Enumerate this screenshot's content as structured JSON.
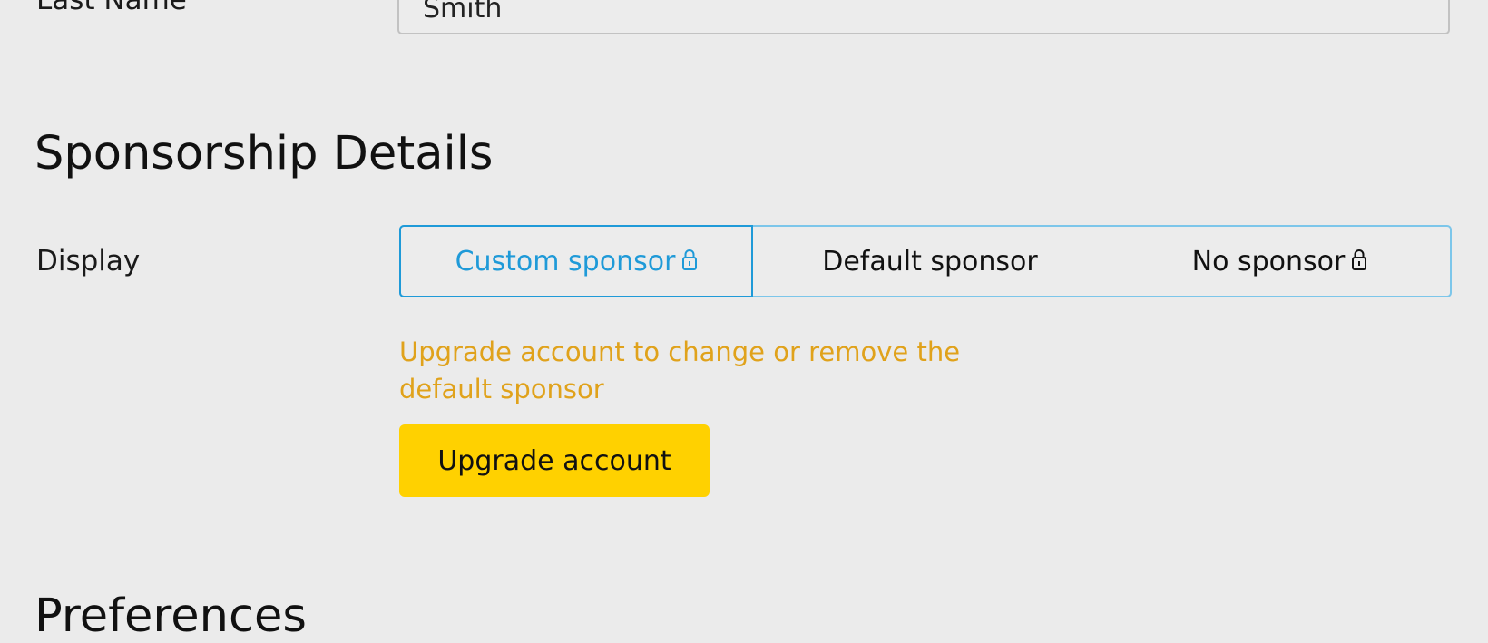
{
  "personal": {
    "last_name_label": "Last Name",
    "last_name_value": "Smith"
  },
  "sponsorship": {
    "title": "Sponsorship Details",
    "display_label": "Display",
    "options": [
      {
        "label": "Custom sponsor",
        "locked": true,
        "selected": true
      },
      {
        "label": "Default sponsor",
        "locked": false,
        "selected": false
      },
      {
        "label": "No sponsor",
        "locked": true,
        "selected": false
      }
    ],
    "upgrade_message": "Upgrade account to change or remove the default sponsor",
    "upgrade_button": "Upgrade account"
  },
  "preferences": {
    "title": "Preferences"
  },
  "colors": {
    "background": "#ebebeb",
    "accent_blue": "#1f9ad8",
    "warning_orange": "#e0a21b",
    "upgrade_yellow": "#ffd100"
  },
  "icons": {
    "lock": "lock-icon"
  }
}
